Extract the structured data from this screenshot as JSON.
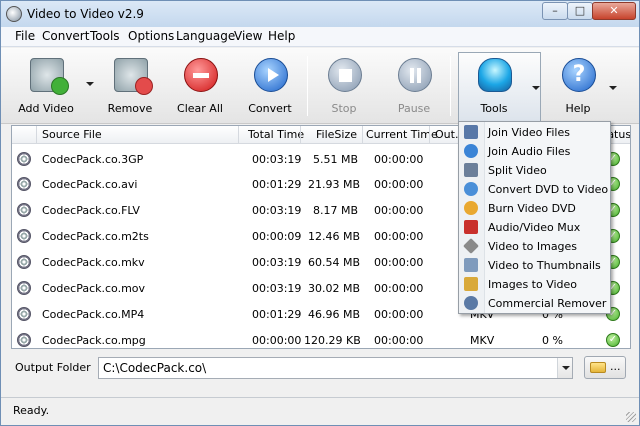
{
  "window": {
    "title": "Video to Video v2.9",
    "min": "–",
    "max": "□",
    "close": "✕"
  },
  "menubar": [
    "File",
    "Convert",
    "Tools",
    "Options",
    "Language",
    "View",
    "Help"
  ],
  "toolbar": {
    "add_video": "Add Video",
    "remove": "Remove",
    "clear_all": "Clear All",
    "convert": "Convert",
    "stop": "Stop",
    "pause": "Pause",
    "tools": "Tools",
    "help": "Help",
    "help_glyph": "?"
  },
  "table": {
    "headers": [
      "Source File",
      "Total Time",
      "FileSize",
      "Current Time",
      "Out.",
      "tatus"
    ],
    "rows": [
      {
        "file": "CodecPack.co.3GP",
        "total": "00:03:19",
        "size": "5.51 MB",
        "current": "00:00:00",
        "out": "",
        "progress": ""
      },
      {
        "file": "CodecPack.co.avi",
        "total": "00:01:29",
        "size": "21.93 MB",
        "current": "00:00:00",
        "out": "",
        "progress": ""
      },
      {
        "file": "CodecPack.co.FLV",
        "total": "00:03:19",
        "size": "8.17 MB",
        "current": "00:00:00",
        "out": "",
        "progress": ""
      },
      {
        "file": "CodecPack.co.m2ts",
        "total": "00:00:09",
        "size": "12.46 MB",
        "current": "00:00:00",
        "out": "",
        "progress": ""
      },
      {
        "file": "CodecPack.co.mkv",
        "total": "00:03:19",
        "size": "60.54 MB",
        "current": "00:00:00",
        "out": "",
        "progress": ""
      },
      {
        "file": "CodecPack.co.mov",
        "total": "00:03:19",
        "size": "30.02 MB",
        "current": "00:00:00",
        "out": "",
        "progress": ""
      },
      {
        "file": "CodecPack.co.MP4",
        "total": "00:01:29",
        "size": "46.96 MB",
        "current": "00:00:00",
        "out": "MKV",
        "progress": "0 %"
      },
      {
        "file": "CodecPack.co.mpg",
        "total": "00:00:00",
        "size": "120.29 KB",
        "current": "00:00:00",
        "out": "MKV",
        "progress": "0 %"
      }
    ],
    "status_glyph": "✓"
  },
  "output": {
    "label": "Output Folder",
    "path": "C:\\CodecPack.co\\",
    "browse_dots": "..."
  },
  "status": {
    "text": "Ready."
  },
  "tools_menu": {
    "items": [
      {
        "label": "Join Video Files",
        "icon": "join-video-icon",
        "color": "#5878a8"
      },
      {
        "label": "Join Audio Files",
        "icon": "join-audio-icon",
        "color": "#3b84d6"
      },
      {
        "label": "Split Video",
        "icon": "split-video-icon",
        "color": "#6b7f9a"
      },
      {
        "label": "Convert DVD to Video",
        "icon": "dvd-convert-icon",
        "color": "#4a8fd8"
      },
      {
        "label": "Burn Video DVD",
        "icon": "dvd-burn-icon",
        "color": "#e9a830"
      },
      {
        "label": "Audio/Video Mux",
        "icon": "mux-icon",
        "color": "#c9302c"
      },
      {
        "label": "Video to Images",
        "icon": "video-images-icon",
        "color": "#8a8a8a"
      },
      {
        "label": "Video to Thumbnails",
        "icon": "thumbnails-icon",
        "color": "#7f9bbd"
      },
      {
        "label": "Images to Video",
        "icon": "images-video-icon",
        "color": "#d9a93a"
      },
      {
        "label": "Commercial Remover",
        "icon": "scissors-icon",
        "color": "#5a79a5"
      }
    ]
  }
}
